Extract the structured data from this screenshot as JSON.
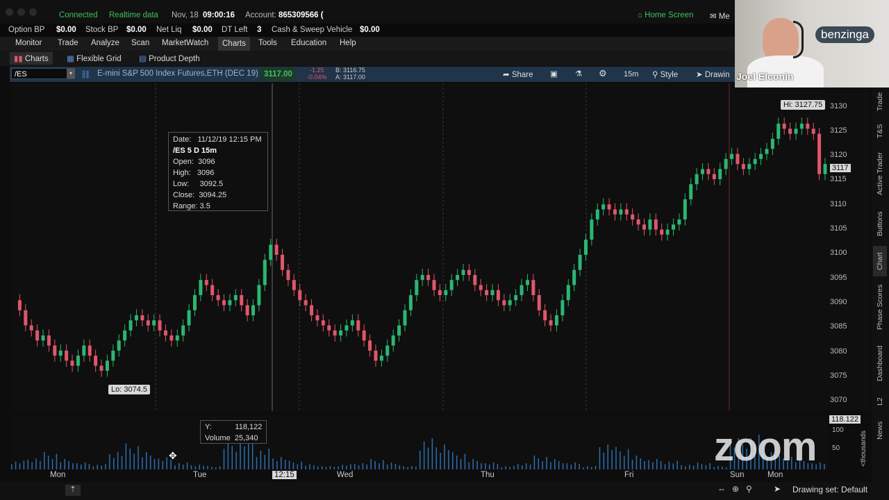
{
  "status": {
    "connected": "Connected",
    "realtime": "Realtime data",
    "date": "Nov, 18",
    "time": "09:00:16",
    "account_label": "Account:",
    "account_value": "865309566 (",
    "home_screen": "Home Screen",
    "messages": "Me"
  },
  "balances": [
    {
      "label": "Option BP",
      "value": "$0.00"
    },
    {
      "label": "Stock BP",
      "value": "$0.00"
    },
    {
      "label": "Net Liq",
      "value": "$0.00"
    },
    {
      "label": "DT Left",
      "value": "3"
    },
    {
      "label": "Cash & Sweep Vehicle",
      "value": "$0.00"
    }
  ],
  "menu": [
    "Monitor",
    "Trade",
    "Analyze",
    "Scan",
    "MarketWatch",
    "Charts",
    "Tools",
    "Education",
    "Help"
  ],
  "subtabs": {
    "charts": "Charts",
    "flexible_grid": "Flexible Grid",
    "product_depth": "Product Depth"
  },
  "symbol_bar": {
    "symbol": "/ES",
    "description": "E-mini S&P 500 Index Futures,ETH (DEC 19)",
    "last": "3117.00",
    "change": "-1.25",
    "change_pct": "-0.04%",
    "bid": "B: 3116.75",
    "ask": "A: 3117.00",
    "share": "Share",
    "interval": "15m",
    "style": "Style",
    "drawings": "Drawin"
  },
  "tooltip": {
    "date_label": "Date:",
    "date_value": "11/12/19 12:15 PM",
    "title": "/ES 5 D 15m",
    "open_label": "Open:",
    "open_value": "3096",
    "high_label": "High:",
    "high_value": "3096",
    "low_label": "Low:",
    "low_value": "3092.5",
    "close_label": "Close:",
    "close_value": "3094.25",
    "range_label": "Range:",
    "range_value": "3.5"
  },
  "vol_tooltip": {
    "y_label": "Y:",
    "y_value": "118,122",
    "volume_label": "Volume",
    "volume_value": "25,340"
  },
  "hi_label": "Hi: 3127.75",
  "lo_label": "Lo: 3074.5",
  "price_ticks": [
    "3130",
    "3125",
    "3120",
    "3115",
    "3110",
    "3105",
    "3100",
    "3095",
    "3090",
    "3085",
    "3080",
    "3075",
    "3070"
  ],
  "last_price_tag": "3117",
  "vol_ticks": {
    "top": "118.122",
    "mid": "100",
    "low": "50",
    "unit": "<thousands"
  },
  "date_ticks": [
    "Mon",
    "Tue",
    "12:15",
    "Wed",
    "Thu",
    "Fri",
    "Sun",
    "Mon"
  ],
  "right_tabs": [
    "Trade",
    "T&S",
    "Active Trader",
    "Buttons",
    "Chart",
    "Phase Scores",
    "Dashboard",
    "L2",
    "News"
  ],
  "bottom": {
    "drawing_set": "Drawing set: Default"
  },
  "webcam": {
    "name": "Joel Elconin",
    "brand": "benzinga"
  },
  "overlay": {
    "zoom": "zoom"
  },
  "colors": {
    "up": "#2bb673",
    "down": "#e0566b",
    "accent": "#3fc060"
  },
  "chart_data": {
    "type": "candlestick",
    "y_range": [
      3068,
      3133
    ],
    "symbol": "/ES",
    "interval": "15m",
    "sessions": [
      "Mon",
      "Tue",
      "Wed",
      "Thu",
      "Fri",
      "Sun",
      "Mon"
    ],
    "path": [
      3090,
      3088,
      3085,
      3084,
      3082,
      3083,
      3081,
      3079,
      3080,
      3078,
      3077,
      3079,
      3081,
      3079,
      3077,
      3076,
      3078,
      3080,
      3082,
      3084,
      3086,
      3087,
      3086,
      3085,
      3086,
      3084,
      3083,
      3082,
      3083,
      3085,
      3088,
      3091,
      3094,
      3093,
      3091,
      3090,
      3089,
      3090,
      3091,
      3089,
      3087,
      3089,
      3093,
      3098,
      3101,
      3099,
      3096,
      3094,
      3092,
      3090,
      3089,
      3087,
      3086,
      3085,
      3084,
      3083,
      3084,
      3085,
      3086,
      3084,
      3082,
      3080,
      3078,
      3079,
      3081,
      3083,
      3085,
      3088,
      3091,
      3094,
      3095,
      3094,
      3092,
      3091,
      3092,
      3094,
      3095,
      3096,
      3095,
      3093,
      3092,
      3091,
      3092,
      3090,
      3089,
      3090,
      3091,
      3093,
      3094,
      3091,
      3088,
      3086,
      3085,
      3087,
      3090,
      3093,
      3096,
      3099,
      3102,
      3106,
      3108,
      3109,
      3108,
      3107,
      3108,
      3107,
      3106,
      3105,
      3104,
      3106,
      3104,
      3103,
      3104,
      3105,
      3106,
      3110,
      3113,
      3115,
      3116,
      3115,
      3114,
      3116,
      3118,
      3119,
      3117,
      3116,
      3117,
      3118,
      3119,
      3120,
      3122,
      3125,
      3124,
      3123,
      3124,
      3125,
      3124,
      3123,
      3115,
      3117
    ],
    "volume_relative": [
      0.25,
      0.35,
      0.5,
      0.3,
      0.2,
      0.15,
      0.55,
      0.75,
      0.5,
      0.35,
      0.2,
      0.15,
      0.1,
      0.85,
      0.95,
      0.6,
      0.4,
      0.25,
      0.15,
      0.1,
      0.15,
      0.2,
      0.3,
      0.2,
      0.1,
      0.9,
      0.8,
      0.5,
      0.3,
      0.2,
      0.1,
      0.2,
      0.4,
      0.3,
      0.2,
      0.1,
      0.8,
      0.65,
      0.4,
      0.3,
      0.25,
      0.15,
      0.2,
      0.1,
      0.9,
      1.0,
      0.55,
      0.4,
      0.3,
      0.2
    ]
  }
}
